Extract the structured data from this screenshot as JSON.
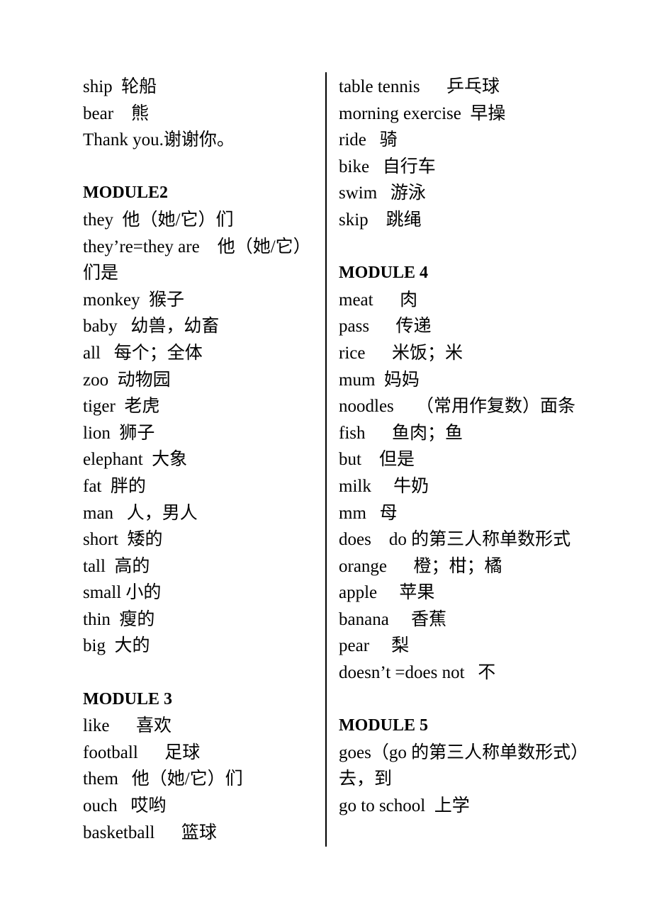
{
  "document": {
    "type": "vocabulary-list",
    "columns": [
      {
        "name": "left-column",
        "blocks": [
          {
            "kind": "entry",
            "text": "ship  轮船"
          },
          {
            "kind": "entry",
            "text": "bear    熊"
          },
          {
            "kind": "entry",
            "text": "Thank you.谢谢你。"
          },
          {
            "kind": "spacer",
            "text": ""
          },
          {
            "kind": "heading",
            "text": "MODULE2"
          },
          {
            "kind": "entry",
            "text": "they  他（她/它）们"
          },
          {
            "kind": "entry",
            "text": "they’re=they are    他（她/它）们是"
          },
          {
            "kind": "entry",
            "text": "monkey  猴子"
          },
          {
            "kind": "entry",
            "text": "baby   幼兽，幼畜"
          },
          {
            "kind": "entry",
            "text": "all   每个；全体"
          },
          {
            "kind": "entry",
            "text": "zoo  动物园"
          },
          {
            "kind": "entry",
            "text": "tiger  老虎"
          },
          {
            "kind": "entry",
            "text": "lion  狮子"
          },
          {
            "kind": "entry",
            "text": "elephant  大象"
          },
          {
            "kind": "entry",
            "text": "fat  胖的"
          },
          {
            "kind": "entry",
            "text": "man   人，男人"
          },
          {
            "kind": "entry",
            "text": "short  矮的"
          },
          {
            "kind": "entry",
            "text": "tall  高的"
          },
          {
            "kind": "entry",
            "text": "small 小的"
          },
          {
            "kind": "entry",
            "text": "thin  瘦的"
          },
          {
            "kind": "entry",
            "text": "big  大的"
          },
          {
            "kind": "spacer",
            "text": ""
          },
          {
            "kind": "heading",
            "text": "MODULE 3"
          },
          {
            "kind": "entry",
            "text": "like      喜欢"
          },
          {
            "kind": "entry",
            "text": "football      足球"
          },
          {
            "kind": "entry",
            "text": "them   他（她/它）们"
          },
          {
            "kind": "entry",
            "text": "ouch   哎哟"
          },
          {
            "kind": "entry",
            "text": "basketball      篮球"
          }
        ]
      },
      {
        "name": "right-column",
        "blocks": [
          {
            "kind": "entry",
            "text": "table tennis      乒乓球"
          },
          {
            "kind": "entry",
            "text": "morning exercise  早操"
          },
          {
            "kind": "entry",
            "text": "ride   骑"
          },
          {
            "kind": "entry",
            "text": "bike   自行车"
          },
          {
            "kind": "entry",
            "text": "swim   游泳"
          },
          {
            "kind": "entry",
            "text": "skip    跳绳"
          },
          {
            "kind": "spacer",
            "text": ""
          },
          {
            "kind": "heading",
            "text": "MODULE 4"
          },
          {
            "kind": "entry",
            "text": "meat      肉"
          },
          {
            "kind": "entry",
            "text": "pass      传递"
          },
          {
            "kind": "entry",
            "text": "rice      米饭；米"
          },
          {
            "kind": "entry",
            "text": "mum  妈妈"
          },
          {
            "kind": "entry",
            "text": "noodles     （常用作复数）面条"
          },
          {
            "kind": "entry",
            "text": "fish      鱼肉；鱼"
          },
          {
            "kind": "entry",
            "text": "but    但是"
          },
          {
            "kind": "entry",
            "text": "milk     牛奶"
          },
          {
            "kind": "entry",
            "text": "mm   母"
          },
          {
            "kind": "entry",
            "text": "does    do 的第三人称单数形式"
          },
          {
            "kind": "entry",
            "text": "orange      橙；柑；橘"
          },
          {
            "kind": "entry",
            "text": "apple     苹果"
          },
          {
            "kind": "entry",
            "text": "banana     香蕉"
          },
          {
            "kind": "entry",
            "text": "pear     梨"
          },
          {
            "kind": "entry",
            "text": "doesn’t =does not   不"
          },
          {
            "kind": "spacer",
            "text": ""
          },
          {
            "kind": "heading",
            "text": "MODULE 5"
          },
          {
            "kind": "entry",
            "text": "goes（go 的第三人称单数形式）去，到"
          },
          {
            "kind": "entry",
            "text": "go to school  上学"
          }
        ]
      }
    ]
  }
}
